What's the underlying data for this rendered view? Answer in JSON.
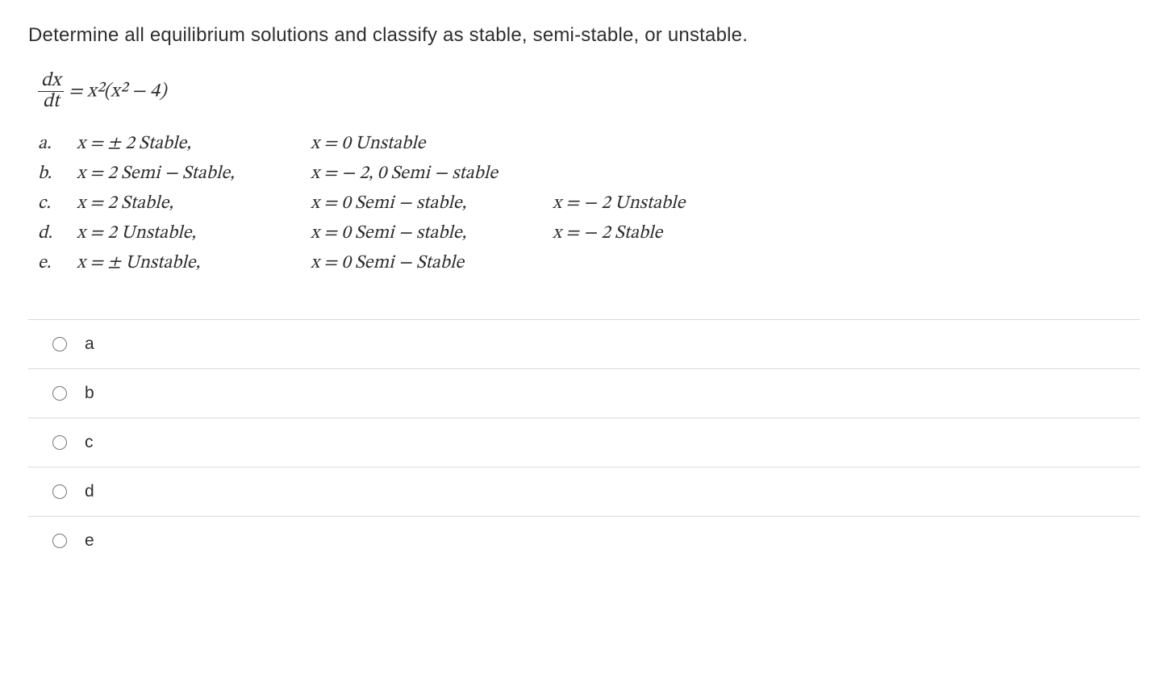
{
  "question": "Determine all equilibrium solutions and classify as stable, semi-stable, or unstable.",
  "equation": {
    "lhs_num": "dx",
    "lhs_den": "dt",
    "rhs": " = x²(x² − 4)"
  },
  "answers": [
    {
      "label": "a.",
      "c1": "x = ± 2  Stable,",
      "c2": "x = 0  Unstable",
      "c3": ""
    },
    {
      "label": "b.",
      "c1": "x = 2   Semi − Stable,",
      "c2": "x = − 2, 0  Semi − stable",
      "c3": ""
    },
    {
      "label": "c.",
      "c1": "x = 2  Stable,",
      "c2": "x = 0 Semi − stable,",
      "c3": "x = − 2 Unstable"
    },
    {
      "label": "d.",
      "c1": "x = 2   Unstable,",
      "c2": "x = 0 Semi − stable,",
      "c3": "x = − 2 Stable"
    },
    {
      "label": "e.",
      "c1": "x = ±   Unstable,",
      "c2": "x = 0 Semi − Stable",
      "c3": ""
    }
  ],
  "options": [
    "a",
    "b",
    "c",
    "d",
    "e"
  ]
}
